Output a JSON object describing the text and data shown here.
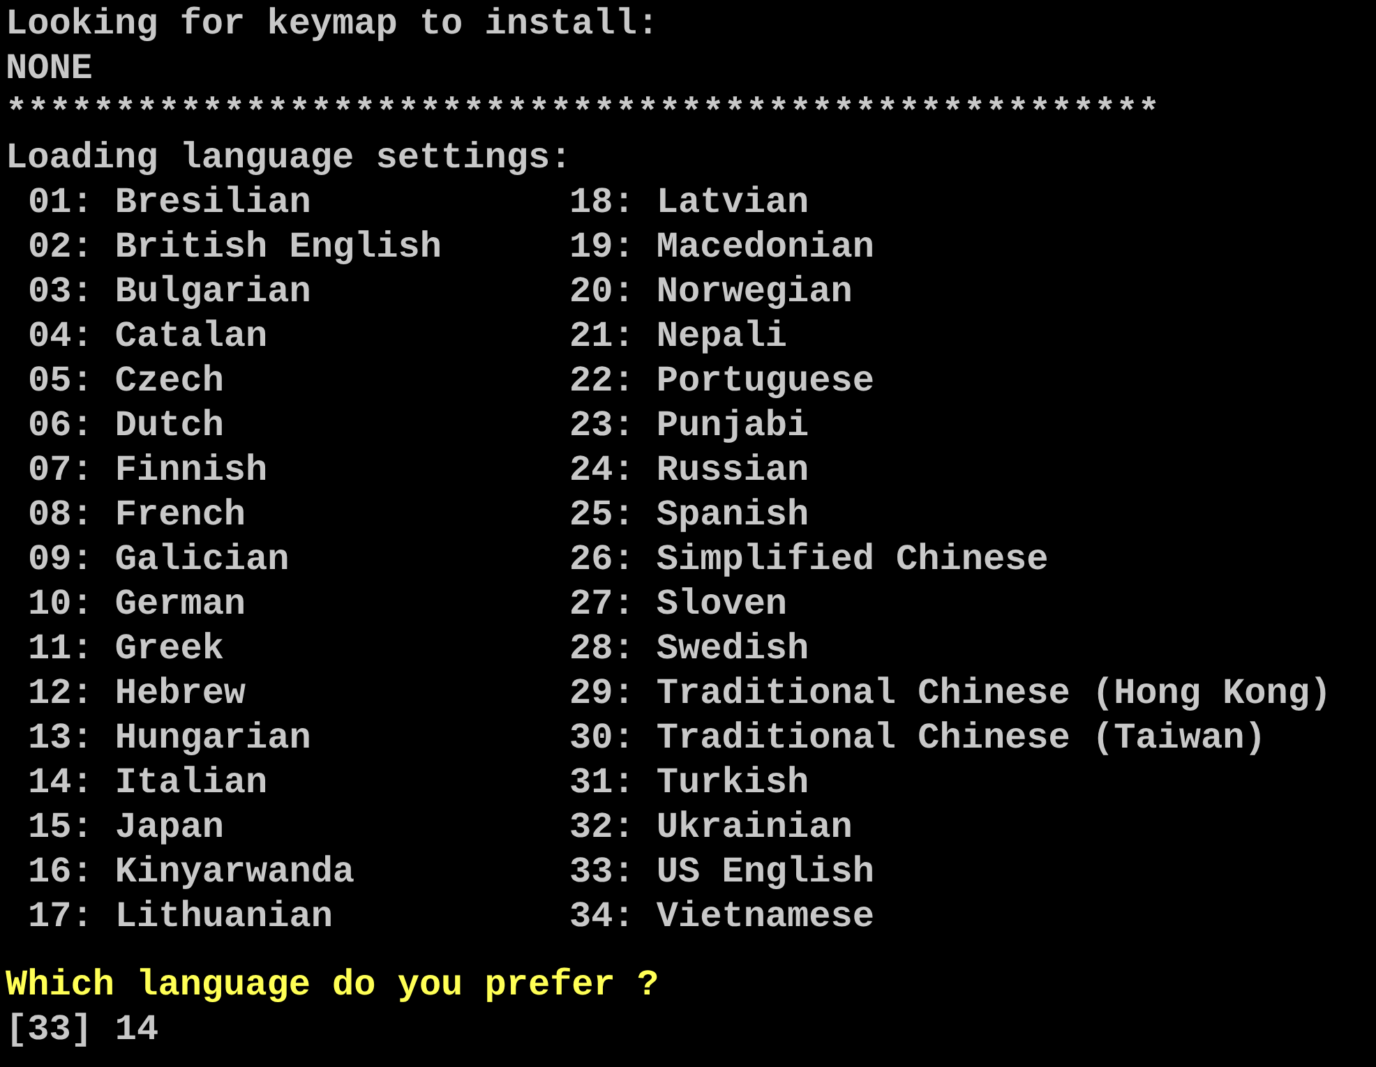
{
  "lines": [
    "Looking for keymap to install:",
    "NONE",
    "*****************************************************",
    "Loading language settings:"
  ],
  "languages": {
    "left": [
      "01: Bresilian",
      "02: British English",
      "03: Bulgarian",
      "04: Catalan",
      "05: Czech",
      "06: Dutch",
      "07: Finnish",
      "08: French",
      "09: Galician",
      "10: German",
      "11: Greek",
      "12: Hebrew",
      "13: Hungarian",
      "14: Italian",
      "15: Japan",
      "16: Kinyarwanda",
      "17: Lithuanian"
    ],
    "right": [
      "18: Latvian",
      "19: Macedonian",
      "20: Norwegian",
      "21: Nepali",
      "22: Portuguese",
      "23: Punjabi",
      "24: Russian",
      "25: Spanish",
      "26: Simplified Chinese",
      "27: Sloven",
      "28: Swedish",
      "29: Traditional Chinese (Hong Kong)",
      "30: Traditional Chinese (Taiwan)",
      "31: Turkish",
      "32: Ukrainian",
      "33: US English",
      "34: Vietnamese"
    ]
  },
  "prompt": "Which language do you prefer ?",
  "input": {
    "default": "[33]",
    "value": "14"
  }
}
